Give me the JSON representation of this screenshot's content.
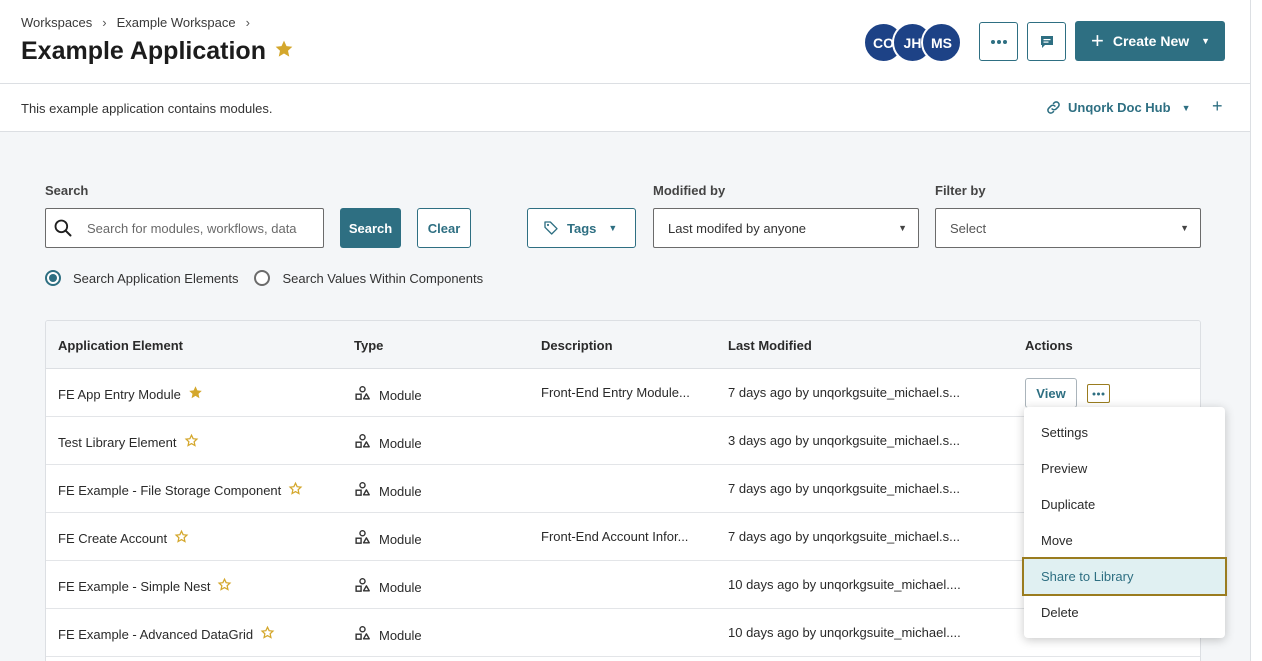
{
  "breadcrumb": [
    "Workspaces",
    "Example Workspace"
  ],
  "page_title": "Example Application",
  "avatars": [
    "CO",
    "JH",
    "MS"
  ],
  "header_actions": {
    "create_new_label": "Create New"
  },
  "description": "This example application contains modules.",
  "doc_hub": {
    "label": "Unqork Doc Hub"
  },
  "filters": {
    "search_label": "Search",
    "search_placeholder": "Search for modules, workflows, data",
    "search_button": "Search",
    "clear_button": "Clear",
    "tags_button": "Tags",
    "modified_by_label": "Modified by",
    "modified_by_value": "Last modifed by anyone",
    "filter_by_label": "Filter by",
    "filter_by_value": "Select"
  },
  "radio_options": [
    {
      "label": "Search Application Elements",
      "checked": true
    },
    {
      "label": "Search Values Within Components",
      "checked": false
    }
  ],
  "table": {
    "columns": [
      "Application Element",
      "Type",
      "Description",
      "Last Modified",
      "Actions"
    ],
    "view_label": "View",
    "rows": [
      {
        "name": "FE App Entry Module",
        "starred": true,
        "type": "Module",
        "description": "Front-End Entry Module...",
        "modified": "7 days ago by unqorkgsuite_michael.s..."
      },
      {
        "name": "Test Library Element",
        "starred": false,
        "type": "Module",
        "description": "",
        "modified": "3 days ago by unqorkgsuite_michael.s..."
      },
      {
        "name": "FE Example - File Storage Component",
        "starred": false,
        "type": "Module",
        "description": "",
        "modified": "7 days ago by unqorkgsuite_michael.s..."
      },
      {
        "name": "FE Create Account",
        "starred": false,
        "type": "Module",
        "description": "Front-End Account Infor...",
        "modified": "7 days ago by unqorkgsuite_michael.s..."
      },
      {
        "name": "FE Example - Simple Nest",
        "starred": false,
        "type": "Module",
        "description": "",
        "modified": "10 days ago by unqorkgsuite_michael...."
      },
      {
        "name": "FE Example - Advanced DataGrid",
        "starred": false,
        "type": "Module",
        "description": "",
        "modified": "10 days ago by unqorkgsuite_michael...."
      }
    ]
  },
  "actions_menu": [
    "Settings",
    "Preview",
    "Duplicate",
    "Move",
    "Share to Library",
    "Delete"
  ],
  "colors": {
    "primary": "#2e6f82",
    "avatar": "#1d4286",
    "star": "#d4a72c",
    "highlight_border": "#9a7c1f",
    "highlight_bg": "#e0f0f2"
  }
}
